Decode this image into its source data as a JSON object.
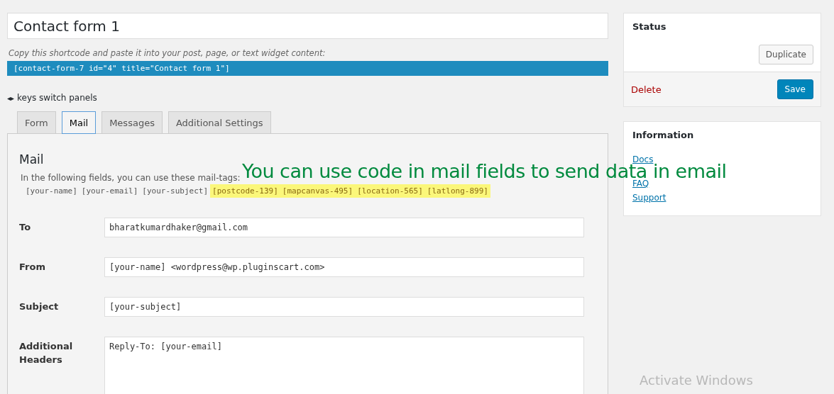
{
  "form_title": {
    "value": "Contact form 1"
  },
  "shortcode": {
    "hint": "Copy this shortcode and paste it into your post, page, or text widget content:",
    "code": "[contact-form-7 id=\"4\" title=\"Contact form 1\"]"
  },
  "keys_hint": {
    "icon": "◂▸",
    "text": "keys switch panels"
  },
  "tabs": [
    {
      "label": "Form",
      "selected": false
    },
    {
      "label": "Mail",
      "selected": true
    },
    {
      "label": "Messages",
      "selected": false
    },
    {
      "label": "Additional Settings",
      "selected": false
    }
  ],
  "panel": {
    "heading": "Mail",
    "intro": "In the following fields, you can use these mail-tags:",
    "mail_tags": [
      {
        "tag": "[your-name]",
        "highlighted": false
      },
      {
        "tag": "[your-email]",
        "highlighted": false
      },
      {
        "tag": "[your-subject]",
        "highlighted": false
      },
      {
        "tag": "[postcode-139]",
        "highlighted": true
      },
      {
        "tag": "[mapcanvas-495]",
        "highlighted": true
      },
      {
        "tag": "[location-565]",
        "highlighted": true
      },
      {
        "tag": "[latlong-899]",
        "highlighted": true
      }
    ],
    "fields": [
      {
        "kind": "input",
        "label": "To",
        "value": "bharatkumardhaker@gmail.com"
      },
      {
        "kind": "input",
        "label": "From",
        "value": "[your-name] <wordpress@wp.pluginscart.com>"
      },
      {
        "kind": "input",
        "label": "Subject",
        "value": "[your-subject]"
      },
      {
        "kind": "textarea",
        "label": "Additional Headers",
        "value": "Reply-To: [your-email]"
      }
    ]
  },
  "status_box": {
    "title": "Status",
    "duplicate": "Duplicate",
    "delete": "Delete",
    "save": "Save"
  },
  "info_box": {
    "title": "Information",
    "links": [
      "Docs",
      "FAQ",
      "Support"
    ]
  },
  "annotation": "You can use code in mail fields to send data in email",
  "os_notice": "Activate Windows"
}
